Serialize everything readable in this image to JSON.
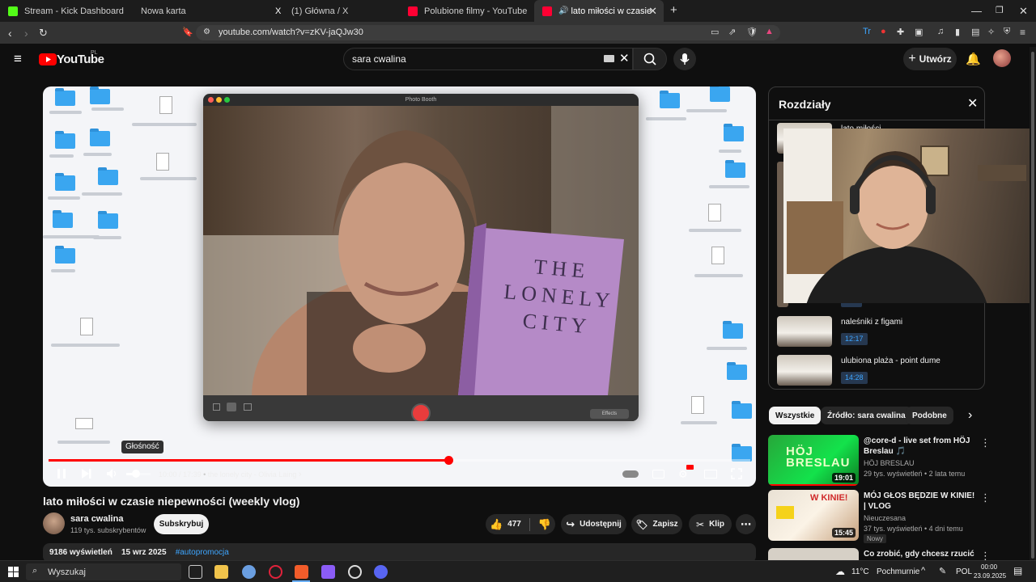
{
  "browser": {
    "tabs": [
      {
        "label": "Stream - Kick Dashboard",
        "color": "#53fc18",
        "active": false
      },
      {
        "label": "Nowa karta",
        "color": "",
        "active": false
      },
      {
        "label": "(1) Główna / X",
        "color": "#ffffff",
        "active": false
      },
      {
        "label": "Polubione filmy - YouTube",
        "color": "#ff0033",
        "active": false
      },
      {
        "label": "lato miłości w czasie niepewn",
        "color": "#ff0033",
        "active": true
      }
    ],
    "new_tab_symbol": "+",
    "url": "youtube.com/watch?v=zKV-jaQJw30"
  },
  "youtube": {
    "logo_text": "YouTube",
    "region": "PL",
    "search_query": "sara cwalina",
    "create_label": "Utwórz"
  },
  "player": {
    "booth_title": "Photo Booth",
    "effects_label": "Effects",
    "book_text": [
      "THE",
      "LONELY",
      "CITY"
    ],
    "tooltip": "Głośność",
    "time_current": "10:00",
    "time_total": "17:39",
    "time_separator": "/",
    "chapter_label": "the lonely city - Olivia Laing",
    "progress": 0.57,
    "volume": 0.4
  },
  "chapters": {
    "title": "Rozdziały",
    "first_partial": "lato miłości",
    "items": [
      {
        "name": "naleśniki z figami",
        "time": "12:17"
      },
      {
        "name": "ulubiona plaża - point dume",
        "time": "14:28"
      }
    ]
  },
  "chips": [
    "Wszystkie",
    "Źródło: sara cwalina",
    "Podobne"
  ],
  "recommendations": [
    {
      "title": "@core-d - live set from HÖJ Breslau 🎵",
      "channel": "HÖJ BRESLAU",
      "meta": "29 tys. wyświetleń • 2 lata temu",
      "duration": "19:01",
      "thumb_text": "HÖJ BRESLAU",
      "badge": ""
    },
    {
      "title": "MÓJ GŁOS BĘDZIE W KINIE! | VLOG",
      "channel": "Nieuczesana",
      "meta": "37 tys. wyświetleń • 4 dni temu",
      "duration": "15:45",
      "thumb_text": "W KINIE!",
      "badge": "Nowy"
    },
    {
      "title": "Co zrobić, gdy chcesz rzucić",
      "channel": "",
      "meta": "",
      "duration": "",
      "thumb_text": "",
      "badge": ""
    }
  ],
  "video": {
    "title": "lato miłości w czasie niepewności (weekly vlog)",
    "channel": "sara cwalina",
    "subscribers": "119 tys. subskrybentów",
    "subscribe_label": "Subskrybuj",
    "likes": "477",
    "share_label": "Udostępnij",
    "save_label": "Zapisz",
    "clip_label": "Klip",
    "views": "9186 wyświetleń",
    "date": "15 wrz 2025",
    "hashtag": "#autopromocja"
  },
  "taskbar": {
    "search_label": "Wyszukaj",
    "weather_temp": "11°C",
    "weather_desc": "Pochmurnie",
    "lang": "POL",
    "time": "00:00",
    "date": "23.09.2025"
  },
  "colors": {
    "accent_red": "#ff0000",
    "link_blue": "#3ea6ff",
    "bg": "#0f0f0f"
  }
}
